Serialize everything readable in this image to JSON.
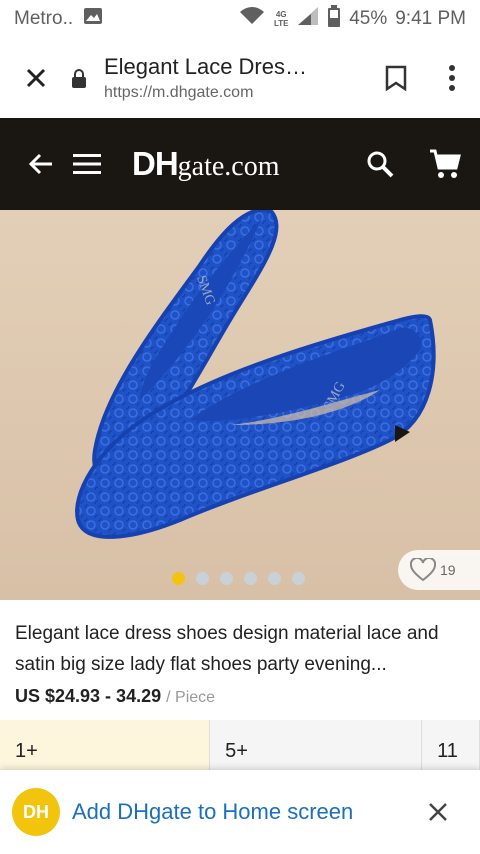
{
  "status": {
    "carrier": "Metro..",
    "battery": "45%",
    "time": "9:41 PM",
    "net_badge": "4G LTE"
  },
  "browser": {
    "title": "Elegant Lace Dres…",
    "url": "https://m.dhgate.com"
  },
  "site": {
    "logo_dh": "DH",
    "logo_rest": "gate.com"
  },
  "product": {
    "image_label_1": "SMG",
    "image_label_2": "SMG",
    "favorites": "19",
    "title": "Elegant lace dress shoes design material lace and satin big size lady flat shoes party evening...",
    "price": "US $24.93 - 34.29",
    "unit": "/ Piece",
    "dots_total": 6,
    "dots_active": 1
  },
  "tiers": [
    "1+",
    "5+",
    "11"
  ],
  "banner": {
    "logo": "DH",
    "text": "Add DHgate to Home screen"
  },
  "colors": {
    "header_bg": "#1a1712",
    "accent_yellow": "#f3c40d",
    "link_blue": "#1b6fbf",
    "shoe_blue": "#1a4fc4"
  }
}
